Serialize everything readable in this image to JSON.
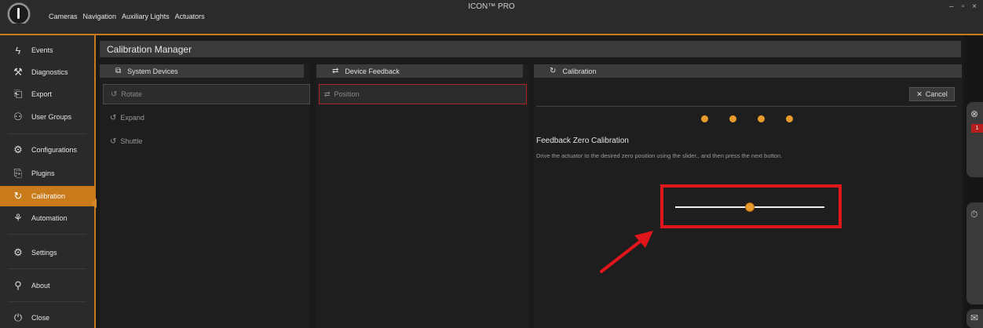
{
  "window": {
    "title": "ICON™ PRO",
    "controls": [
      "–",
      "▫",
      "×"
    ]
  },
  "topnav": {
    "items": [
      "Cameras",
      "Navigation",
      "Auxiliary Lights",
      "Actuators"
    ]
  },
  "sidebar": {
    "items": [
      {
        "label": "Events",
        "icon": "lightning-icon",
        "glyph": "ϟ"
      },
      {
        "label": "Diagnostics",
        "icon": "wrench-icon",
        "glyph": "⚒"
      },
      {
        "label": "Export",
        "icon": "usb-icon",
        "glyph": "⎗"
      },
      {
        "label": "User Groups",
        "icon": "users-icon",
        "glyph": "⚇"
      },
      {
        "label": "Configurations",
        "icon": "gears-icon",
        "glyph": "⚙"
      },
      {
        "label": "Plugins",
        "icon": "plugin-icon",
        "glyph": "⎘"
      },
      {
        "label": "Calibration",
        "icon": "calibration-icon",
        "glyph": "↻"
      },
      {
        "label": "Automation",
        "icon": "automation-icon",
        "glyph": "⚘"
      },
      {
        "label": "Settings",
        "icon": "settings-icon",
        "glyph": "⚙"
      },
      {
        "label": "About",
        "icon": "about-icon",
        "glyph": "⚲"
      },
      {
        "label": "Close",
        "icon": "power-icon",
        "glyph": "⏻"
      }
    ],
    "active": "Calibration",
    "accent": "#c97a1a"
  },
  "main": {
    "title": "Calibration Manager"
  },
  "panels": {
    "system_devices": {
      "title": "System Devices",
      "items": [
        "Rotate",
        "Expand",
        "Shuttle"
      ],
      "selected": "Rotate"
    },
    "device_feedback": {
      "title": "Device Feedback",
      "items": [
        "Position"
      ],
      "selected": "Position"
    },
    "calibration": {
      "title": "Calibration",
      "cancel_label": "Cancel",
      "heading": "Feedback Zero Calibration",
      "instructions": "Drive the actuator to the desired zero position using the slider., and then press the next button.",
      "steps": 4,
      "slider_value": 0.5
    }
  },
  "right_edge": {
    "badge_count": "1"
  },
  "colors": {
    "accent": "#c97a1a",
    "step_dot": "#e89a2a",
    "highlight": "#e0161c"
  }
}
